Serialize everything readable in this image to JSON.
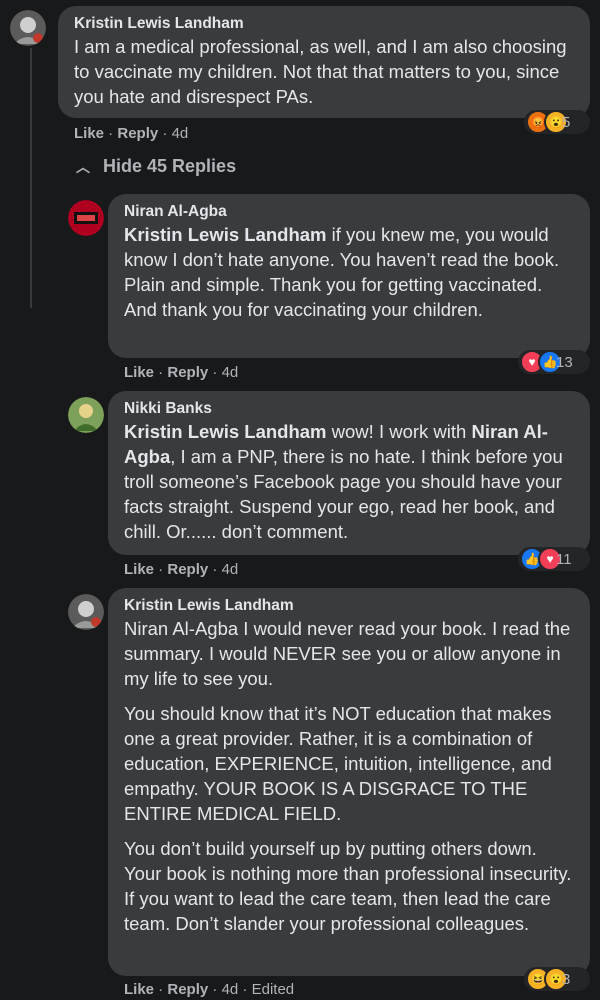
{
  "comments": [
    {
      "author": "Kristin Lewis Landham",
      "text": "I am a medical professional, as well, and I am also choosing to vaccinate my children. Not that that matters to you, since you hate and disrespect PAs.",
      "actions": {
        "like": "Like",
        "reply": "Reply",
        "time": "4d"
      },
      "reactions": {
        "icons": [
          "angry-icon",
          "wow-icon"
        ],
        "count": "5"
      }
    }
  ],
  "hide_replies": "Hide 45 Replies",
  "replies": [
    {
      "author": "Niran Al-Agba",
      "mention": "Kristin Lewis Landham",
      "text": " if you knew me, you would know I don’t hate anyone. You haven’t read the book. Plain and simple. Thank you for getting vaccinated. And thank you for vaccinating your children.",
      "actions": {
        "like": "Like",
        "reply": "Reply",
        "time": "4d"
      },
      "reactions": {
        "icons": [
          "love-icon",
          "like-icon"
        ],
        "count": "13"
      }
    },
    {
      "author": "Nikki Banks",
      "mention": "Kristin Lewis Landham",
      "text_a": " wow! I work with ",
      "mention2": "Niran Al-Agba",
      "text_b": ", I am a PNP, there is no hate. I think before you troll someone’s Facebook page you should have your facts straight. Suspend your ego, read her book, and chill. Or...... don’t comment.",
      "actions": {
        "like": "Like",
        "reply": "Reply",
        "time": "4d"
      },
      "reactions": {
        "icons": [
          "like-icon",
          "love-icon"
        ],
        "count": "11"
      }
    },
    {
      "author": "Kristin Lewis Landham",
      "paragraphs": [
        "Niran Al-Agba I would never read your book. I read the summary. I would NEVER see you or allow anyone in my life to see you.",
        "You should know that it’s NOT education that makes one a great provider. Rather, it is a combination of education, EXPERIENCE, intuition, intelligence, and empathy. YOUR BOOK IS A DISGRACE TO THE ENTIRE MEDICAL FIELD.",
        "You don’t build yourself up by putting others down. Your book is nothing more than professional insecurity. If you want to lead the care team, then lead the care team. Don’t slander your professional colleagues."
      ],
      "actions": {
        "like": "Like",
        "reply": "Reply",
        "time": "4d",
        "edited": "Edited"
      },
      "reactions": {
        "icons": [
          "haha-icon",
          "wow-icon"
        ],
        "count": "3"
      }
    }
  ],
  "colors": {
    "background": "#18191a",
    "bubble": "#3a3b3c",
    "text": "#e4e6eb",
    "muted": "#b0b3b8",
    "like": "#1877f2",
    "love": "#f33e58",
    "angry": "#e9710f",
    "wow": "#f7b125"
  }
}
